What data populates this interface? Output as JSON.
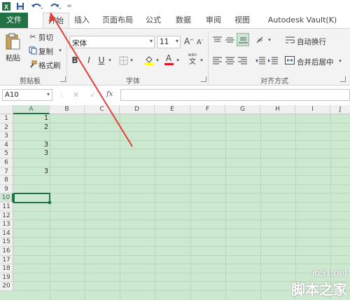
{
  "quick_access": {
    "excel_icon": "excel-logo-icon",
    "save_icon": "save-icon",
    "undo_icon": "undo-icon",
    "redo_icon": "redo-icon",
    "customize": "="
  },
  "tabs": [
    "文件",
    "开始",
    "插入",
    "页面布局",
    "公式",
    "数据",
    "审阅",
    "视图",
    "Autodesk Vault(K)"
  ],
  "ribbon": {
    "clipboard": {
      "paste": "粘贴",
      "cut": "剪切",
      "copy": "复制",
      "format_painter": "格式刷",
      "label": "剪贴板"
    },
    "font": {
      "name": "宋体",
      "size": "11",
      "grow": "A",
      "shrink": "A",
      "bold": "B",
      "italic": "I",
      "underline": "U",
      "font_color": "A",
      "phonetic_top": "wén",
      "phonetic_bottom": "文",
      "label": "字体"
    },
    "alignment": {
      "wrap_text": "自动换行",
      "merge_center": "合并后居中",
      "label": "对齐方式"
    }
  },
  "formula_bar": {
    "name_box": "A10",
    "fx": "fx",
    "value": ""
  },
  "columns": [
    "A",
    "B",
    "C",
    "D",
    "E",
    "F",
    "G",
    "H",
    "I",
    "J"
  ],
  "rows": [
    "1",
    "2",
    "3",
    "4",
    "5",
    "6",
    "7",
    "8",
    "9",
    "10",
    "11",
    "12",
    "13",
    "14",
    "15",
    "16",
    "17",
    "18",
    "19",
    "20"
  ],
  "cells": {
    "A1": "1",
    "A2": "2",
    "A4": "3",
    "A5": "3",
    "A7": "3"
  },
  "selected_cell": "A10",
  "colors": {
    "accent": "#217346",
    "sheet_bg": "#cce8cf",
    "arrow": "#e0403a"
  },
  "watermark": {
    "site": "jb51.net",
    "brand": "脚本之家"
  }
}
